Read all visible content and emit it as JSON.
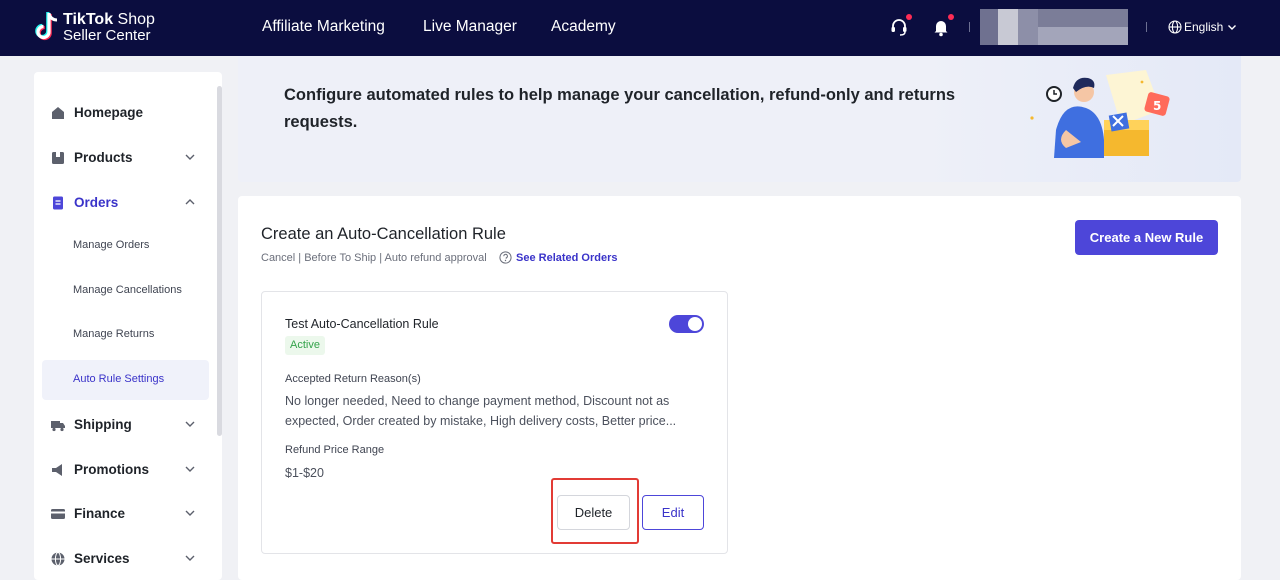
{
  "header": {
    "brand_line1_bold": "TikTok",
    "brand_line1_rest": " Shop",
    "brand_line2": "Seller Center",
    "nav": [
      "Affiliate Marketing",
      "Live Manager",
      "Academy"
    ],
    "language": "English"
  },
  "sidebar": {
    "items": [
      {
        "label": "Homepage",
        "icon": "home-icon"
      },
      {
        "label": "Products",
        "icon": "products-icon"
      },
      {
        "label": "Orders",
        "icon": "orders-icon"
      },
      {
        "label": "Shipping",
        "icon": "truck-icon"
      },
      {
        "label": "Promotions",
        "icon": "megaphone-icon"
      },
      {
        "label": "Finance",
        "icon": "card-icon"
      },
      {
        "label": "Services",
        "icon": "globe-icon"
      }
    ],
    "order_subitems": [
      "Manage Orders",
      "Manage Cancellations",
      "Manage Returns",
      "Auto Rule Settings"
    ],
    "active_subitem": "Auto Rule Settings"
  },
  "banner": {
    "text": "Configure automated rules to help manage your cancellation, refund-only and returns requests."
  },
  "main": {
    "title": "Create an Auto-Cancellation Rule",
    "subtitle": "Cancel | Before To Ship | Auto refund approval",
    "related_link": "See Related Orders",
    "create_button": "Create a New Rule"
  },
  "rule": {
    "name": "Test Auto-Cancellation Rule",
    "status": "Active",
    "enabled": true,
    "reasons_label": "Accepted Return Reason(s)",
    "reasons": "No longer needed, Need to change payment method, Discount not as expected, Order created by mistake, High delivery costs, Better price...",
    "price_label": "Refund Price Range",
    "price_range": "$1-$20",
    "delete_label": "Delete",
    "edit_label": "Edit"
  },
  "colors": {
    "header_bg": "#0b0d3f",
    "accent": "#4d46d9",
    "active_badge": "#33a34a",
    "highlight": "#e23b35"
  }
}
